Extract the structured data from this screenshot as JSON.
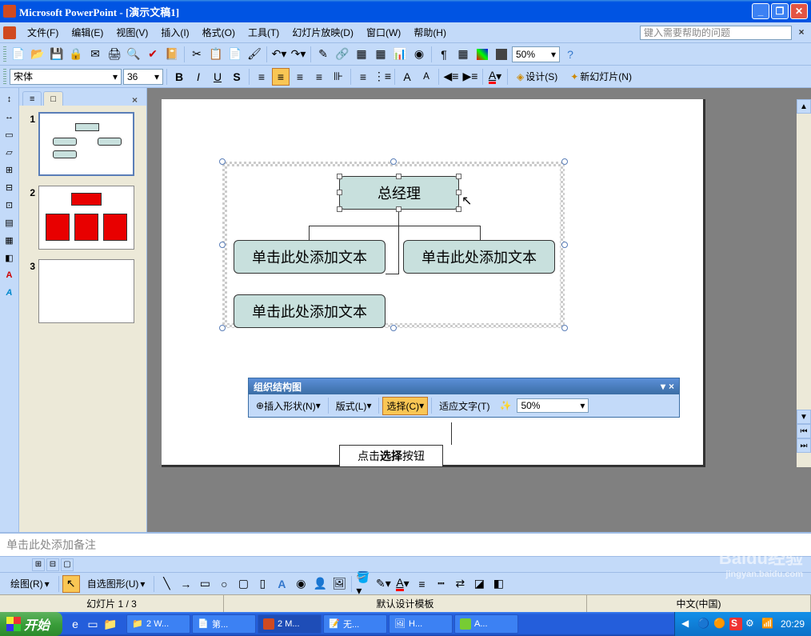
{
  "titlebar": {
    "title": "Microsoft PowerPoint - [演示文稿1]"
  },
  "menubar": {
    "items": [
      "文件(F)",
      "编辑(E)",
      "视图(V)",
      "插入(I)",
      "格式(O)",
      "工具(T)",
      "幻灯片放映(D)",
      "窗口(W)",
      "帮助(H)"
    ],
    "help_placeholder": "键入需要帮助的问题"
  },
  "toolbar1": {
    "zoom": "50%"
  },
  "toolbar2": {
    "font": "宋体",
    "size": "36",
    "design": "设计(S)",
    "newslide": "新幻灯片(N)"
  },
  "slides": {
    "tabs": {
      "outline": "≡",
      "slides": "□"
    },
    "items": [
      {
        "num": "1"
      },
      {
        "num": "2"
      },
      {
        "num": "3"
      }
    ]
  },
  "org": {
    "top": "总经理",
    "b1": "单击此处添加文本",
    "b2": "单击此处添加文本",
    "b3": "单击此处添加文本"
  },
  "float_toolbar": {
    "title": "组织结构图",
    "insert_shape": "插入形状(N)",
    "layout": "版式(L)",
    "select": "选择(C)",
    "fit_text": "适应文字(T)",
    "zoom": "50%"
  },
  "callout": {
    "prefix": "点击",
    "bold": "选择",
    "suffix": "按钮"
  },
  "notes": {
    "placeholder": "单击此处添加备注"
  },
  "drawing": {
    "draw": "绘图(R)",
    "autoshapes": "自选图形(U)"
  },
  "status": {
    "slide": "幻灯片 1 / 3",
    "template": "默认设计模板",
    "lang": "中文(中国)"
  },
  "taskbar": {
    "start": "开始",
    "items": [
      "2 W...",
      "第...",
      "2 M...",
      "无...",
      "H...",
      "A..."
    ],
    "clock": "20:29"
  },
  "watermark": {
    "main": "Baidu经验",
    "sub": "jingyan.baidu.com"
  }
}
